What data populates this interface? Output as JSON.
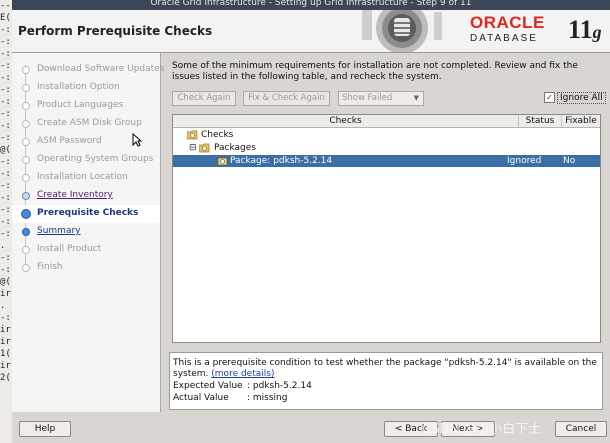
{
  "terminal_lines": [
    "--",
    "E(",
    "-:",
    "-:",
    "-:",
    "-:",
    "-:",
    "-:",
    "-:",
    "-:",
    "-:",
    "-:",
    "@(",
    "-:",
    "-:",
    "-:",
    "-:",
    "-:",
    "-:",
    "-:",
    ".",
    "-:",
    "-:",
    "@(",
    "ir",
    ".",
    "-:",
    "ir",
    "ir",
    "1(",
    "ir",
    "2(",
    "",
    ""
  ],
  "title_bar": "Oracle Grid Infrastructure - Setting up Grid Infrastructure - Step 9 of 11",
  "header": {
    "title": "Perform Prerequisite Checks",
    "brand_top": "ORACLE",
    "brand_bottom": "DATABASE",
    "version": "11",
    "version_suffix": "g"
  },
  "steps": [
    {
      "label": "Download Software Updates",
      "state": "done"
    },
    {
      "label": "Installation Option",
      "state": "done"
    },
    {
      "label": "Product Languages",
      "state": "done"
    },
    {
      "label": "Create ASM Disk Group",
      "state": "done"
    },
    {
      "label": "ASM Password",
      "state": "done"
    },
    {
      "label": "Operating System Groups",
      "state": "done"
    },
    {
      "label": "Installation Location",
      "state": "done"
    },
    {
      "label": "Create Inventory",
      "state": "link"
    },
    {
      "label": "Prerequisite Checks",
      "state": "current"
    },
    {
      "label": "Summary",
      "state": "next"
    },
    {
      "label": "Install Product",
      "state": "pending"
    },
    {
      "label": "Finish",
      "state": "pending"
    }
  ],
  "main": {
    "message": "Some of the minimum requirements for installation are not completed. Review and fix the issues listed in the following table, and recheck the system.",
    "check_again": "Check Again",
    "fix_check": "Fix & Check Again",
    "filter_value": "Show Failed",
    "ignore_all": "Ignore All",
    "ignore_all_checked": true,
    "columns": {
      "checks": "Checks",
      "status": "Status",
      "fixable": "Fixable"
    },
    "rows": [
      {
        "label": "Checks",
        "status": "",
        "fixable": ""
      },
      {
        "label": "Packages",
        "status": "",
        "fixable": ""
      },
      {
        "label": "Package: pdksh-5.2.14",
        "status": "Ignored",
        "fixable": "No"
      }
    ]
  },
  "details": {
    "line1": "This is a prerequisite condition to test whether the package \"pdksh-5.2.14\" is available on the",
    "line2_prefix": "system.",
    "more_link": "(more details)",
    "expected_label": "Expected Value",
    "expected_value": ": pdksh-5.2.14",
    "actual_label": "Actual Value",
    "actual_value": ": missing"
  },
  "buttons": {
    "help": "Help",
    "back": "< Back",
    "next": "Next >",
    "cancel": "Cancel"
  },
  "watermark": "CSDN @小小白下士"
}
